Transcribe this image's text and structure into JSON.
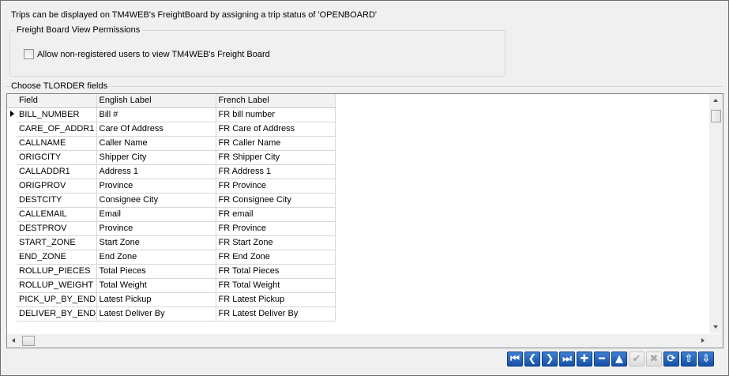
{
  "info_text": "Trips can be displayed on TM4WEB's FreightBoard by assigning a trip status of 'OPENBOARD'",
  "permissions": {
    "group_title": "Freight Board View Permissions",
    "checkbox_label": "Allow non-registered users to view TM4WEB's Freight Board",
    "checked": false
  },
  "fields": {
    "group_title": "Choose TLORDER fields",
    "columns": [
      "Field",
      "English Label",
      "French Label"
    ],
    "rows": [
      {
        "field": "BILL_NUMBER",
        "english": "Bill #",
        "french": "FR bill number",
        "current": true
      },
      {
        "field": "CARE_OF_ADDR1",
        "english": "Care Of Address",
        "french": "FR Care of Address"
      },
      {
        "field": "CALLNAME",
        "english": "Caller Name",
        "french": "FR Caller Name"
      },
      {
        "field": "ORIGCITY",
        "english": "Shipper City",
        "french": "FR Shipper City"
      },
      {
        "field": "CALLADDR1",
        "english": "Address 1",
        "french": "FR Address 1"
      },
      {
        "field": "ORIGPROV",
        "english": "Province",
        "french": "FR Province"
      },
      {
        "field": "DESTCITY",
        "english": "Consignee City",
        "french": "FR Consignee City"
      },
      {
        "field": "CALLEMAIL",
        "english": "Email",
        "french": "FR email"
      },
      {
        "field": "DESTPROV",
        "english": "Province",
        "french": "FR Province"
      },
      {
        "field": "START_ZONE",
        "english": "Start Zone",
        "french": "FR Start Zone"
      },
      {
        "field": "END_ZONE",
        "english": "End Zone",
        "french": "FR End Zone"
      },
      {
        "field": "ROLLUP_PIECES",
        "english": "Total Pieces",
        "french": "FR Total Pieces"
      },
      {
        "field": "ROLLUP_WEIGHT",
        "english": "Total Weight",
        "french": "FR Total Weight"
      },
      {
        "field": "PICK_UP_BY_END",
        "english": "Latest Pickup",
        "french": "FR Latest Pickup"
      },
      {
        "field": "DELIVER_BY_END",
        "english": "Latest Deliver By",
        "french": "FR Latest Deliver By"
      }
    ]
  },
  "navigator": [
    {
      "name": "first-record-icon",
      "glyph": "⏮",
      "enabled": true
    },
    {
      "name": "prior-record-icon",
      "glyph": "❮",
      "enabled": true
    },
    {
      "name": "next-record-icon",
      "glyph": "❯",
      "enabled": true
    },
    {
      "name": "last-record-icon",
      "glyph": "⏭",
      "enabled": true
    },
    {
      "name": "insert-record-icon",
      "glyph": "✚",
      "enabled": true
    },
    {
      "name": "delete-record-icon",
      "glyph": "━",
      "enabled": true
    },
    {
      "name": "edit-record-icon",
      "glyph": "▲",
      "enabled": true
    },
    {
      "name": "post-record-icon",
      "glyph": "✔",
      "enabled": false
    },
    {
      "name": "cancel-record-icon",
      "glyph": "✖",
      "enabled": false
    },
    {
      "name": "refresh-icon",
      "glyph": "⟳",
      "enabled": true
    },
    {
      "name": "move-up-icon",
      "glyph": "⇧",
      "enabled": true
    },
    {
      "name": "move-down-icon",
      "glyph": "⇩",
      "enabled": true
    }
  ]
}
